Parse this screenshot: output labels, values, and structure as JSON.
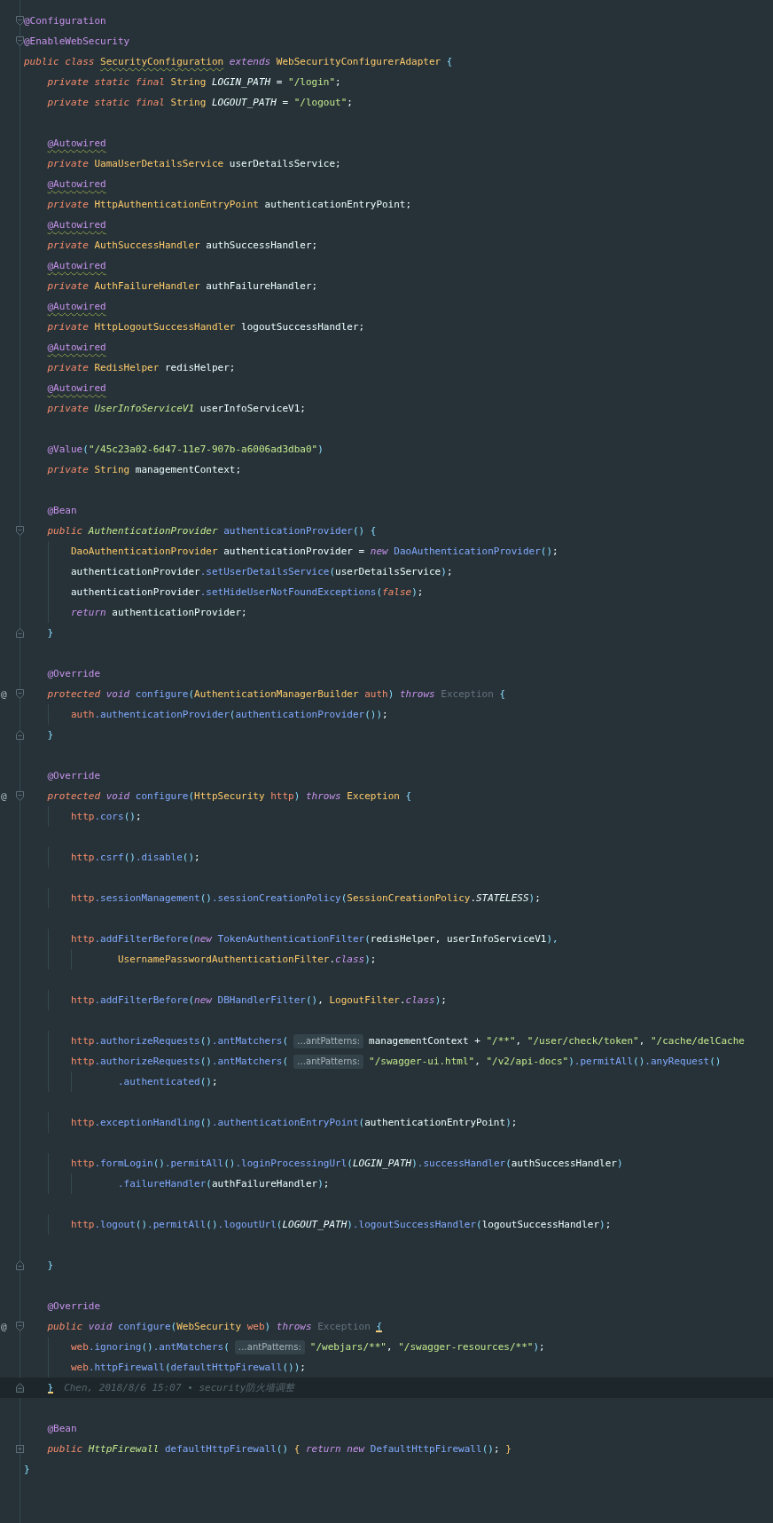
{
  "editor": {
    "lines": [
      {
        "current": false,
        "kind": "top",
        "gutter": [
          {
            "kind": "fold-start"
          }
        ],
        "tokens": [
          {
            "kind": "ann",
            "text": "@Configuration"
          }
        ]
      },
      {
        "current": false,
        "kind": "top",
        "gutter": [
          {
            "kind": "fold-start"
          }
        ],
        "tokens": [
          {
            "kind": "ann",
            "text": "@EnableWebSecurity"
          }
        ]
      },
      {
        "current": false,
        "kind": "top",
        "tokens": [
          {
            "kind": "kw",
            "text": "public class "
          },
          {
            "kind": "type-warn",
            "text": "SecurityConfiguration"
          },
          {
            "kind": "kw2",
            "text": " extends "
          },
          {
            "kind": "type",
            "text": "WebSecurityConfigurerAdapter "
          },
          {
            "kind": "punc",
            "text": "{"
          }
        ]
      },
      {
        "current": false,
        "kind": "member",
        "tokens": [
          {
            "kind": "kw",
            "text": "private static final "
          },
          {
            "kind": "type",
            "text": "String "
          },
          {
            "kind": "const",
            "text": "LOGIN_PATH"
          },
          {
            "kind": "plain",
            "text": " = "
          },
          {
            "kind": "str",
            "text": "\"/login\""
          },
          {
            "kind": "plain",
            "text": ";"
          }
        ]
      },
      {
        "current": false,
        "kind": "member",
        "tokens": [
          {
            "kind": "kw",
            "text": "private static final "
          },
          {
            "kind": "type",
            "text": "String "
          },
          {
            "kind": "const",
            "text": "LOGOUT_PATH"
          },
          {
            "kind": "plain",
            "text": " = "
          },
          {
            "kind": "str",
            "text": "\"/logout\""
          },
          {
            "kind": "plain",
            "text": ";"
          }
        ]
      },
      {
        "current": false
      },
      {
        "current": false,
        "kind": "member",
        "tokens": [
          {
            "kind": "ann-warn",
            "text": "@Autowired"
          }
        ]
      },
      {
        "current": false,
        "kind": "member",
        "tokens": [
          {
            "kind": "kw",
            "text": "private "
          },
          {
            "kind": "type",
            "text": "UamaUserDetailsService "
          },
          {
            "kind": "plain",
            "text": "userDetailsService;"
          }
        ]
      },
      {
        "current": false,
        "kind": "member",
        "tokens": [
          {
            "kind": "ann-warn",
            "text": "@Autowired"
          }
        ]
      },
      {
        "current": false,
        "kind": "member",
        "tokens": [
          {
            "kind": "kw",
            "text": "private "
          },
          {
            "kind": "type",
            "text": "HttpAuthenticationEntryPoint "
          },
          {
            "kind": "plain",
            "text": "authenticationEntryPoint;"
          }
        ]
      },
      {
        "current": false,
        "kind": "member",
        "tokens": [
          {
            "kind": "ann-warn",
            "text": "@Autowired"
          }
        ]
      },
      {
        "current": false,
        "kind": "member",
        "tokens": [
          {
            "kind": "kw",
            "text": "private "
          },
          {
            "kind": "type",
            "text": "AuthSuccessHandler "
          },
          {
            "kind": "plain",
            "text": "authSuccessHandler;"
          }
        ]
      },
      {
        "current": false,
        "kind": "member",
        "tokens": [
          {
            "kind": "ann-warn",
            "text": "@Autowired"
          }
        ]
      },
      {
        "current": false,
        "kind": "member",
        "tokens": [
          {
            "kind": "kw",
            "text": "private "
          },
          {
            "kind": "type",
            "text": "AuthFailureHandler "
          },
          {
            "kind": "plain",
            "text": "authFailureHandler;"
          }
        ]
      },
      {
        "current": false,
        "kind": "member",
        "tokens": [
          {
            "kind": "ann-warn",
            "text": "@Autowired"
          }
        ]
      },
      {
        "current": false,
        "kind": "member",
        "tokens": [
          {
            "kind": "kw",
            "text": "private "
          },
          {
            "kind": "type",
            "text": "HttpLogoutSuccessHandler "
          },
          {
            "kind": "plain",
            "text": "logoutSuccessHandler;"
          }
        ]
      },
      {
        "current": false,
        "kind": "member",
        "tokens": [
          {
            "kind": "ann-warn",
            "text": "@Autowired"
          }
        ]
      },
      {
        "current": false,
        "kind": "member",
        "tokens": [
          {
            "kind": "kw",
            "text": "private "
          },
          {
            "kind": "type",
            "text": "RedisHelper "
          },
          {
            "kind": "plain",
            "text": "redisHelper;"
          }
        ]
      },
      {
        "current": false,
        "kind": "member",
        "tokens": [
          {
            "kind": "ann-warn",
            "text": "@Autowired"
          }
        ]
      },
      {
        "current": false,
        "kind": "member",
        "tokens": [
          {
            "kind": "kw",
            "text": "private "
          },
          {
            "kind": "itype",
            "text": "UserInfoServiceV1"
          },
          {
            "kind": "plain",
            "text": " userInfoServiceV1;"
          }
        ]
      },
      {
        "current": false
      },
      {
        "current": false,
        "kind": "member",
        "tokens": [
          {
            "kind": "ann",
            "text": "@Value"
          },
          {
            "kind": "punc",
            "text": "("
          },
          {
            "kind": "str",
            "text": "\"/45c23a02-6d47-11e7-907b-a6006ad3dba0\""
          },
          {
            "kind": "punc",
            "text": ")"
          }
        ]
      },
      {
        "current": false,
        "kind": "member",
        "tokens": [
          {
            "kind": "kw",
            "text": "private "
          },
          {
            "kind": "type",
            "text": "String "
          },
          {
            "kind": "plain",
            "text": "managementContext;"
          }
        ]
      },
      {
        "current": false
      },
      {
        "current": false,
        "kind": "member",
        "tokens": [
          {
            "kind": "ann",
            "text": "@Bean"
          }
        ]
      },
      {
        "current": false,
        "kind": "member",
        "gutter": [
          {
            "kind": "fold-start"
          }
        ],
        "tokens": [
          {
            "kind": "kw",
            "text": "public "
          },
          {
            "kind": "itype",
            "text": "AuthenticationProvider "
          },
          {
            "kind": "method",
            "text": "authenticationProvider"
          },
          {
            "kind": "punc",
            "text": "() {"
          }
        ]
      },
      {
        "current": false,
        "kind": "body",
        "tokens": [
          {
            "kind": "type",
            "text": "DaoAuthenticationProvider "
          },
          {
            "kind": "plain",
            "text": "authenticationProvider = "
          },
          {
            "kind": "kw2",
            "text": "new "
          },
          {
            "kind": "method",
            "text": "DaoAuthenticationProvider"
          },
          {
            "kind": "punc",
            "text": "()"
          },
          {
            "kind": "plain",
            "text": ";"
          }
        ]
      },
      {
        "current": false,
        "kind": "body",
        "tokens": [
          {
            "kind": "plain",
            "text": "authenticationProvider"
          },
          {
            "kind": "method",
            "text": ".setUserDetailsService"
          },
          {
            "kind": "punc",
            "text": "("
          },
          {
            "kind": "plain",
            "text": "userDetailsService"
          },
          {
            "kind": "punc",
            "text": ")"
          },
          {
            "kind": "plain",
            "text": ";"
          }
        ]
      },
      {
        "current": false,
        "kind": "body",
        "tokens": [
          {
            "kind": "plain",
            "text": "authenticationProvider"
          },
          {
            "kind": "method",
            "text": ".setHideUserNotFoundExceptions"
          },
          {
            "kind": "punc",
            "text": "("
          },
          {
            "kind": "kw",
            "text": "false"
          },
          {
            "kind": "punc",
            "text": ")"
          },
          {
            "kind": "plain",
            "text": ";"
          }
        ]
      },
      {
        "current": false,
        "kind": "body",
        "tokens": [
          {
            "kind": "kw2",
            "text": "return "
          },
          {
            "kind": "plain",
            "text": "authenticationProvider;"
          }
        ]
      },
      {
        "current": false,
        "kind": "member",
        "gutter": [
          {
            "kind": "fold-end"
          }
        ],
        "tokens": [
          {
            "kind": "punc",
            "text": "}"
          }
        ]
      },
      {
        "current": false
      },
      {
        "current": false,
        "kind": "member",
        "tokens": [
          {
            "kind": "ann",
            "text": "@Override"
          }
        ]
      },
      {
        "current": false,
        "kind": "member",
        "gutter": [
          {
            "kind": "override-mark",
            "text": "@"
          },
          {
            "kind": "fold-start"
          }
        ],
        "tokens": [
          {
            "kind": "kw",
            "text": "protected "
          },
          {
            "kind": "kw2",
            "text": "void "
          },
          {
            "kind": "method",
            "text": "configure"
          },
          {
            "kind": "punc",
            "text": "("
          },
          {
            "kind": "type",
            "text": "AuthenticationManagerBuilder "
          },
          {
            "kind": "param",
            "text": "auth"
          },
          {
            "kind": "punc",
            "text": ") "
          },
          {
            "kind": "kw2",
            "text": "throws "
          },
          {
            "kind": "dim",
            "text": "Exception "
          },
          {
            "kind": "punc",
            "text": "{"
          }
        ]
      },
      {
        "current": false,
        "kind": "body",
        "tokens": [
          {
            "kind": "param",
            "text": "auth"
          },
          {
            "kind": "method",
            "text": ".authenticationProvider"
          },
          {
            "kind": "punc",
            "text": "("
          },
          {
            "kind": "method",
            "text": "authenticationProvider"
          },
          {
            "kind": "punc",
            "text": "())"
          },
          {
            "kind": "plain",
            "text": ";"
          }
        ]
      },
      {
        "current": false,
        "kind": "member",
        "gutter": [
          {
            "kind": "fold-end"
          }
        ],
        "tokens": [
          {
            "kind": "punc",
            "text": "}"
          }
        ]
      },
      {
        "current": false
      },
      {
        "current": false,
        "kind": "member",
        "tokens": [
          {
            "kind": "ann",
            "text": "@Override"
          }
        ]
      },
      {
        "current": false,
        "kind": "member",
        "gutter": [
          {
            "kind": "override-mark",
            "text": "@"
          },
          {
            "kind": "fold-start"
          }
        ],
        "tokens": [
          {
            "kind": "kw",
            "text": "protected "
          },
          {
            "kind": "kw2",
            "text": "void "
          },
          {
            "kind": "method",
            "text": "configure"
          },
          {
            "kind": "punc",
            "text": "("
          },
          {
            "kind": "type",
            "text": "HttpSecurity "
          },
          {
            "kind": "param",
            "text": "http"
          },
          {
            "kind": "punc",
            "text": ") "
          },
          {
            "kind": "kw2",
            "text": "throws "
          },
          {
            "kind": "type",
            "text": "Exception "
          },
          {
            "kind": "punc",
            "text": "{"
          }
        ]
      },
      {
        "current": false,
        "kind": "body",
        "tokens": [
          {
            "kind": "param",
            "text": "http"
          },
          {
            "kind": "method",
            "text": ".cors"
          },
          {
            "kind": "punc",
            "text": "()"
          },
          {
            "kind": "plain",
            "text": ";"
          }
        ]
      },
      {
        "current": false
      },
      {
        "current": false,
        "kind": "body",
        "tokens": [
          {
            "kind": "param",
            "text": "http"
          },
          {
            "kind": "method",
            "text": ".csrf"
          },
          {
            "kind": "punc",
            "text": "()"
          },
          {
            "kind": "method",
            "text": ".disable"
          },
          {
            "kind": "punc",
            "text": "()"
          },
          {
            "kind": "plain",
            "text": ";"
          }
        ]
      },
      {
        "current": false
      },
      {
        "current": false,
        "kind": "body",
        "tokens": [
          {
            "kind": "param",
            "text": "http"
          },
          {
            "kind": "method",
            "text": ".sessionManagement"
          },
          {
            "kind": "punc",
            "text": "()"
          },
          {
            "kind": "method",
            "text": ".sessionCreationPolicy"
          },
          {
            "kind": "punc",
            "text": "("
          },
          {
            "kind": "type",
            "text": "SessionCreationPolicy"
          },
          {
            "kind": "plain",
            "text": "."
          },
          {
            "kind": "const",
            "text": "STATELESS"
          },
          {
            "kind": "punc",
            "text": ")"
          },
          {
            "kind": "plain",
            "text": ";"
          }
        ]
      },
      {
        "current": false
      },
      {
        "current": false,
        "kind": "body",
        "tokens": [
          {
            "kind": "param",
            "text": "http"
          },
          {
            "kind": "method",
            "text": ".addFilterBefore"
          },
          {
            "kind": "punc",
            "text": "("
          },
          {
            "kind": "kw2",
            "text": "new "
          },
          {
            "kind": "method",
            "text": "TokenAuthenticationFilter"
          },
          {
            "kind": "punc",
            "text": "("
          },
          {
            "kind": "plain",
            "text": "redisHelper, userInfoServiceV1"
          },
          {
            "kind": "punc",
            "text": "),"
          }
        ]
      },
      {
        "current": false,
        "kind": "wrap",
        "tokens": [
          {
            "kind": "type",
            "text": "UsernamePasswordAuthenticationFilter"
          },
          {
            "kind": "plain",
            "text": "."
          },
          {
            "kind": "kw2",
            "text": "class"
          },
          {
            "kind": "punc",
            "text": ")"
          },
          {
            "kind": "plain",
            "text": ";"
          }
        ]
      },
      {
        "current": false
      },
      {
        "current": false,
        "kind": "body",
        "tokens": [
          {
            "kind": "param",
            "text": "http"
          },
          {
            "kind": "method",
            "text": ".addFilterBefore"
          },
          {
            "kind": "punc",
            "text": "("
          },
          {
            "kind": "kw2",
            "text": "new "
          },
          {
            "kind": "method",
            "text": "DBHandlerFilter"
          },
          {
            "kind": "punc",
            "text": "()"
          },
          {
            "kind": "plain",
            "text": ", "
          },
          {
            "kind": "type",
            "text": "LogoutFilter"
          },
          {
            "kind": "plain",
            "text": "."
          },
          {
            "kind": "kw2",
            "text": "class"
          },
          {
            "kind": "punc",
            "text": ")"
          },
          {
            "kind": "plain",
            "text": ";"
          }
        ]
      },
      {
        "current": false
      },
      {
        "current": false,
        "kind": "body",
        "tokens": [
          {
            "kind": "param",
            "text": "http"
          },
          {
            "kind": "method",
            "text": ".authorizeRequests"
          },
          {
            "kind": "punc",
            "text": "()"
          },
          {
            "kind": "method",
            "text": ".antMatchers"
          },
          {
            "kind": "punc",
            "text": "("
          },
          {
            "kind": "hint",
            "text": "…antPatterns:"
          },
          {
            "kind": "plain",
            "text": "managementContext + "
          },
          {
            "kind": "str",
            "text": "\"/**\""
          },
          {
            "kind": "plain",
            "text": ", "
          },
          {
            "kind": "str",
            "text": "\"/user/check/token\""
          },
          {
            "kind": "plain",
            "text": ", "
          },
          {
            "kind": "str",
            "text": "\"/cache/delCache"
          }
        ]
      },
      {
        "current": false,
        "kind": "body",
        "tokens": [
          {
            "kind": "param",
            "text": "http"
          },
          {
            "kind": "method",
            "text": ".authorizeRequests"
          },
          {
            "kind": "punc",
            "text": "()"
          },
          {
            "kind": "method",
            "text": ".antMatchers"
          },
          {
            "kind": "punc",
            "text": "("
          },
          {
            "kind": "hint",
            "text": "…antPatterns:"
          },
          {
            "kind": "str",
            "text": "\"/swagger-ui.html\""
          },
          {
            "kind": "plain",
            "text": ", "
          },
          {
            "kind": "str",
            "text": "\"/v2/api-docs\""
          },
          {
            "kind": "punc",
            "text": ")"
          },
          {
            "kind": "method",
            "text": ".permitAll"
          },
          {
            "kind": "punc",
            "text": "()"
          },
          {
            "kind": "method",
            "text": ".anyRequest"
          },
          {
            "kind": "punc",
            "text": "()"
          }
        ]
      },
      {
        "current": false,
        "kind": "wrap",
        "tokens": [
          {
            "kind": "method",
            "text": ".authenticated"
          },
          {
            "kind": "punc",
            "text": "()"
          },
          {
            "kind": "plain",
            "text": ";"
          }
        ]
      },
      {
        "current": false
      },
      {
        "current": false,
        "kind": "body",
        "tokens": [
          {
            "kind": "param",
            "text": "http"
          },
          {
            "kind": "method",
            "text": ".exceptionHandling"
          },
          {
            "kind": "punc",
            "text": "()"
          },
          {
            "kind": "method",
            "text": ".authenticationEntryPoint"
          },
          {
            "kind": "punc",
            "text": "("
          },
          {
            "kind": "plain",
            "text": "authenticationEntryPoint"
          },
          {
            "kind": "punc",
            "text": ")"
          },
          {
            "kind": "plain",
            "text": ";"
          }
        ]
      },
      {
        "current": false
      },
      {
        "current": false,
        "kind": "body",
        "tokens": [
          {
            "kind": "param",
            "text": "http"
          },
          {
            "kind": "method",
            "text": ".formLogin"
          },
          {
            "kind": "punc",
            "text": "()"
          },
          {
            "kind": "method",
            "text": ".permitAll"
          },
          {
            "kind": "punc",
            "text": "()"
          },
          {
            "kind": "method",
            "text": ".loginProcessingUrl"
          },
          {
            "kind": "punc",
            "text": "("
          },
          {
            "kind": "const",
            "text": "LOGIN_PATH"
          },
          {
            "kind": "punc",
            "text": ")"
          },
          {
            "kind": "method",
            "text": ".successHandler"
          },
          {
            "kind": "punc",
            "text": "("
          },
          {
            "kind": "plain",
            "text": "authSuccessHandler"
          },
          {
            "kind": "punc",
            "text": ")"
          }
        ]
      },
      {
        "current": false,
        "kind": "wrap",
        "tokens": [
          {
            "kind": "method",
            "text": ".failureHandler"
          },
          {
            "kind": "punc",
            "text": "("
          },
          {
            "kind": "plain",
            "text": "authFailureHandler"
          },
          {
            "kind": "punc",
            "text": ")"
          },
          {
            "kind": "plain",
            "text": ";"
          }
        ]
      },
      {
        "current": false
      },
      {
        "current": false,
        "kind": "body",
        "tokens": [
          {
            "kind": "param",
            "text": "http"
          },
          {
            "kind": "method",
            "text": ".logout"
          },
          {
            "kind": "punc",
            "text": "()"
          },
          {
            "kind": "method",
            "text": ".permitAll"
          },
          {
            "kind": "punc",
            "text": "()"
          },
          {
            "kind": "method",
            "text": ".logoutUrl"
          },
          {
            "kind": "punc",
            "text": "("
          },
          {
            "kind": "const",
            "text": "LOGOUT_PATH"
          },
          {
            "kind": "punc",
            "text": ")"
          },
          {
            "kind": "method",
            "text": ".logoutSuccessHandler"
          },
          {
            "kind": "punc",
            "text": "("
          },
          {
            "kind": "plain",
            "text": "logoutSuccessHandler"
          },
          {
            "kind": "punc",
            "text": ")"
          },
          {
            "kind": "plain",
            "text": ";"
          }
        ]
      },
      {
        "current": false
      },
      {
        "current": false,
        "kind": "member",
        "gutter": [
          {
            "kind": "fold-end"
          }
        ],
        "tokens": [
          {
            "kind": "punc",
            "text": "}"
          }
        ]
      },
      {
        "current": false
      },
      {
        "current": false,
        "kind": "member",
        "tokens": [
          {
            "kind": "ann",
            "text": "@Override"
          }
        ]
      },
      {
        "current": false,
        "kind": "member",
        "gutter": [
          {
            "kind": "override-mark",
            "text": "@"
          },
          {
            "kind": "fold-start"
          }
        ],
        "tokens": [
          {
            "kind": "kw",
            "text": "public "
          },
          {
            "kind": "kw2",
            "text": "void "
          },
          {
            "kind": "method",
            "text": "configure"
          },
          {
            "kind": "punc",
            "text": "("
          },
          {
            "kind": "type",
            "text": "WebSecurity "
          },
          {
            "kind": "param",
            "text": "web"
          },
          {
            "kind": "punc",
            "text": ") "
          },
          {
            "kind": "kw2",
            "text": "throws "
          },
          {
            "kind": "dim",
            "text": "Exception "
          },
          {
            "kind": "brace",
            "text": "{"
          }
        ]
      },
      {
        "current": false,
        "kind": "body",
        "tokens": [
          {
            "kind": "param",
            "text": "web"
          },
          {
            "kind": "method",
            "text": ".ignoring"
          },
          {
            "kind": "punc",
            "text": "()"
          },
          {
            "kind": "method",
            "text": ".antMatchers"
          },
          {
            "kind": "punc",
            "text": "("
          },
          {
            "kind": "hint",
            "text": "…antPatterns:"
          },
          {
            "kind": "str",
            "text": "\"/webjars/**\""
          },
          {
            "kind": "plain",
            "text": ", "
          },
          {
            "kind": "str",
            "text": "\"/swagger-resources/**\""
          },
          {
            "kind": "punc",
            "text": ")"
          },
          {
            "kind": "plain",
            "text": ";"
          }
        ]
      },
      {
        "current": false,
        "kind": "body",
        "tokens": [
          {
            "kind": "param",
            "text": "web"
          },
          {
            "kind": "method",
            "text": ".httpFirewall"
          },
          {
            "kind": "punc",
            "text": "("
          },
          {
            "kind": "method",
            "text": "defaultHttpFirewall"
          },
          {
            "kind": "punc",
            "text": "())"
          },
          {
            "kind": "plain",
            "text": ";"
          }
        ]
      },
      {
        "current": true,
        "kind": "member",
        "gutter": [
          {
            "kind": "fold-end"
          }
        ],
        "tokens": [
          {
            "kind": "brace",
            "text": "}"
          }
        ],
        "blame": "Chen, 2018/8/6 15:07 • security防火墙调整"
      },
      {
        "current": false
      },
      {
        "current": false,
        "kind": "member",
        "tokens": [
          {
            "kind": "ann",
            "text": "@Bean"
          }
        ]
      },
      {
        "current": false,
        "kind": "member",
        "gutter": [
          {
            "kind": "fold-collapsed"
          }
        ],
        "tokens": [
          {
            "kind": "kw",
            "text": "public "
          },
          {
            "kind": "itype",
            "text": "HttpFirewall "
          },
          {
            "kind": "method",
            "text": "defaultHttpFirewall"
          },
          {
            "kind": "punc",
            "text": "() "
          },
          {
            "kind": "type",
            "text": "{ "
          },
          {
            "kind": "kw2",
            "text": "return new "
          },
          {
            "kind": "method",
            "text": "DefaultHttpFirewall"
          },
          {
            "kind": "punc",
            "text": "()"
          },
          {
            "kind": "plain",
            "text": "; "
          },
          {
            "kind": "type",
            "text": "}"
          }
        ]
      },
      {
        "current": false,
        "kind": "top",
        "tokens": [
          {
            "kind": "punc",
            "text": "}"
          }
        ]
      }
    ]
  }
}
